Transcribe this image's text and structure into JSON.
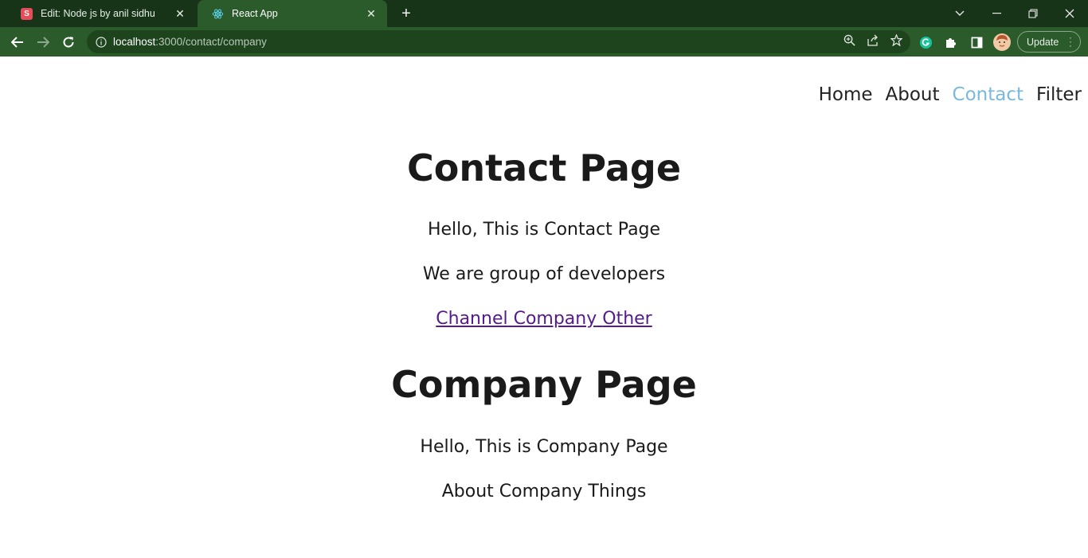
{
  "browser": {
    "tabs": [
      {
        "title": "Edit: Node js by anil sidhu",
        "favicon_letter": "S",
        "active": false
      },
      {
        "title": "React App",
        "active": true
      }
    ],
    "url_host": "localhost",
    "url_path": ":3000/contact/company",
    "update_label": "Update"
  },
  "nav": {
    "items": [
      "Home",
      "About",
      "Contact",
      "Filter"
    ],
    "active_index": 2,
    "active_color": "#7ab8de"
  },
  "contact": {
    "title": "Contact Page",
    "line1": "Hello, This is Contact Page",
    "line2": "We are group of developers",
    "links": [
      "Channel",
      "Company",
      "Other"
    ]
  },
  "company": {
    "title": "Company Page",
    "line1": "Hello, This is Company Page",
    "line2": "About Company Things"
  }
}
